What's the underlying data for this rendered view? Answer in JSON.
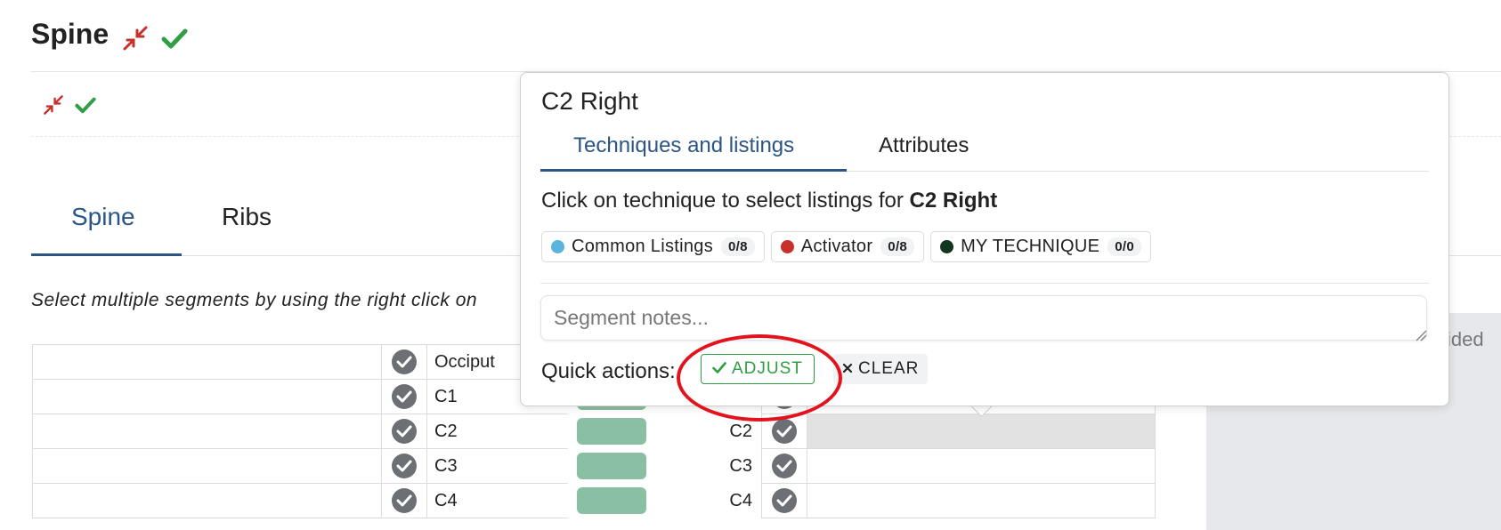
{
  "header": {
    "title": "Spine"
  },
  "tabs": [
    {
      "label": "Spine",
      "active": true
    },
    {
      "label": "Ribs",
      "active": false
    }
  ],
  "help_text": "Select multiple segments by using the right click on",
  "table": {
    "rows": [
      {
        "left_label": "Occiput",
        "right_label": ""
      },
      {
        "left_label": "C1",
        "right_label": ""
      },
      {
        "left_label": "C2",
        "right_label": "C2"
      },
      {
        "left_label": "C3",
        "right_label": "C3"
      },
      {
        "left_label": "C4",
        "right_label": "C4"
      }
    ]
  },
  "side_panel": {
    "text": "ided"
  },
  "popover": {
    "title": "C2 Right",
    "tabs": [
      {
        "label": "Techniques and listings",
        "active": true
      },
      {
        "label": "Attributes",
        "active": false
      }
    ],
    "instruction_prefix": "Click on technique to select listings for",
    "instruction_target": "C2 Right",
    "chips": [
      {
        "label": "Common Listings",
        "count": "0/8",
        "color": "#5ab4dd"
      },
      {
        "label": "Activator",
        "count": "0/8",
        "color": "#c8302c"
      },
      {
        "label": "MY TECHNIQUE",
        "count": "0/0",
        "color": "#13351f"
      }
    ],
    "notes_placeholder": "Segment notes...",
    "quick_actions_label": "Quick actions:",
    "adjust_label": "ADJUST",
    "clear_label": "CLEAR"
  },
  "colors": {
    "accent": "#2a5585",
    "success": "#2f9e44",
    "danger": "#c8302c",
    "highlight": "#e2131d"
  }
}
